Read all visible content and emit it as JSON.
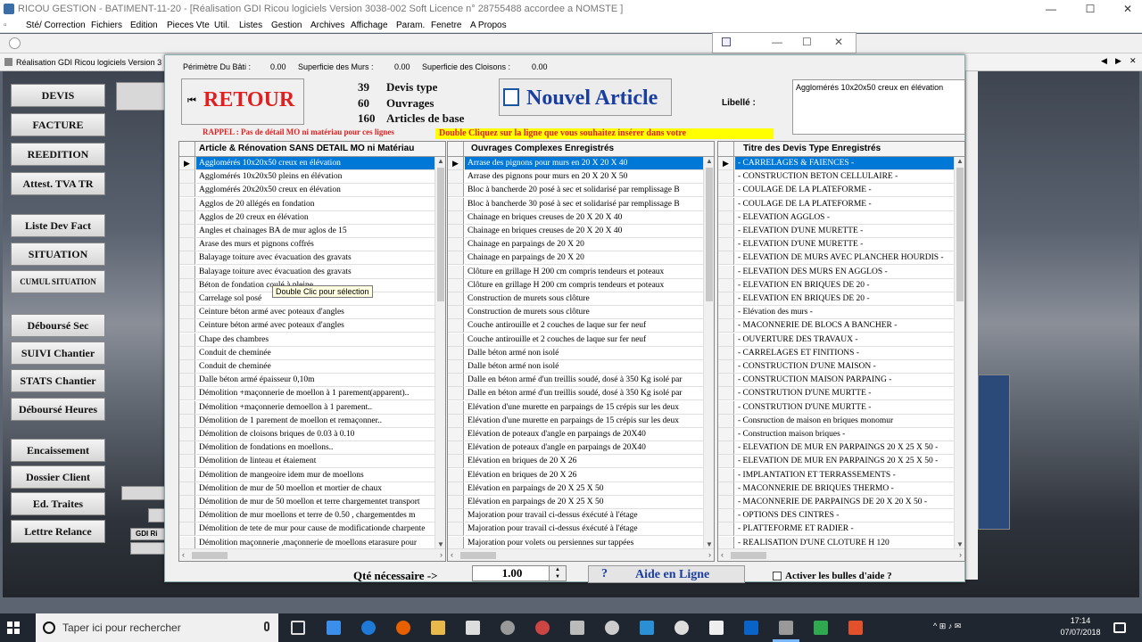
{
  "window": {
    "title": "RICOU GESTION  -  BATIMENT-11-20 - [Réalisation GDI Ricou logiciels Version 3038-002 Soft    Licence n°  28755488 accordee a NOMSTE                ]",
    "minimize": "—",
    "maximize": "☐",
    "close": "✕"
  },
  "menu": [
    "Sté/ Correction",
    "Fichiers",
    "Edition",
    "Pieces Vte",
    "Util.",
    "Listes",
    "Gestion",
    "Archives",
    "Affichage",
    "Param.",
    "Fenetre",
    "A Propos"
  ],
  "doc_tab": "Réalisation GDI Ricou logiciels Version 3",
  "doc_tab_controls": [
    "◀",
    "▶",
    "✕"
  ],
  "sidebar": [
    "DEVIS",
    "FACTURE",
    "REEDITION",
    "Attest. TVA TR",
    "Liste Dev Fact",
    "SITUATION",
    "CUMUL SITUATION",
    "Déboursé Sec",
    "SUIVI Chantier",
    "STATS Chantier",
    "Déboursé Heures",
    "Encaissement",
    "Dossier Client",
    "Ed. Traites",
    "Lettre Relance"
  ],
  "ghost_labels": [
    "GDI Ri"
  ],
  "dialog": {
    "perimetre_label": "Périmètre Du Bâti :",
    "perimetre_value": "0.00",
    "murs_label": "Superficie des Murs :",
    "murs_value": "0.00",
    "cloisons_label": "Superficie des Cloisons :",
    "cloisons_value": "0.00",
    "retour_label": "RETOUR",
    "retour_arrow": "⏮",
    "rappel": "RAPPEL : Pas de détail MO ni matériau pour ces lignes",
    "counts": [
      {
        "num": "39",
        "label": "Devis type"
      },
      {
        "num": "60",
        "label": "Ouvrages"
      },
      {
        "num": "160",
        "label": "Articles de base"
      }
    ],
    "nouvel_label": "Nouvel Article",
    "double_click_hint": "Double Cliquez sur la ligne que vous souhaitez insérer dans votre",
    "libelle_label": "Libellé :",
    "libelle_value": "Agglomérés 10x20x50 creux en élévation",
    "tooltip": "Double Clic pour sélection",
    "qty_label": "Qté nécessaire ->",
    "qty_value": "1.00",
    "aide_label": "Aide en Ligne",
    "aide_q": "?",
    "bulles_label": "Activer les bulles d'aide ?"
  },
  "grids": [
    {
      "header": "Article & Rénovation SANS DETAIL MO ni Matériau",
      "selected_row": 0,
      "rows": [
        "Agglomérés 10x20x50 creux en élévation",
        "Agglomérés 10x20x50 pleins en élévation",
        "Agglomérés 20x20x50 creux en élévation",
        "Agglos de 20 allégés en fondation",
        "Agglos de 20 creux en élévation",
        "Angles et chainages BA de mur aglos de 15",
        "Arase des murs et pignons coffrés",
        "Balayage toiture avec évacuation des gravats",
        "Balayage toiture avec évacuation des gravats",
        "Béton de fondation coulé à pleine",
        "Carrelage sol posé",
        "Ceinture béton armé avec poteaux d'angles",
        "Ceinture béton armé avec poteaux d'angles",
        "Chape des chambres",
        "Conduit de cheminée",
        "Conduit de cheminée",
        "Dalle béton armé épaisseur 0,10m",
        "Démolition +maçonnerie de moellon à 1 parement(apparent)..",
        "Démolition +maçonnerie demoellon à 1 parement..",
        "Démolition de 1 parement de moellon et remaçonner..",
        "Démolition de cloisons briques de 0.03 à 0.10",
        "Démolition de fondations en moellons..",
        "Démolition de linteau et étaiement",
        "Démolition de mangeoire idem mur de moellons",
        "Démolition de mur de 50 moellon et mortier de chaux",
        "Démolition de mur de 50 moellon et terre chargementet transport",
        "Démolition de mur moellons et terre de 0.50 , chargementdes m",
        "Démolition de tete de mur pour cause de modificationde charpente",
        "Démolition maçonnerie ,maçonnerie de moellons etarasure pour"
      ]
    },
    {
      "header": "Ouvrages Complexes Enregistrés",
      "selected_row": 0,
      "rows": [
        "Arrase des pignons pour murs en 20 X 20 X 40",
        "Arrase des pignons pour murs en 20 X 20 X 50",
        "Bloc à bancherde 20 posé à sec et solidarisé par remplissage B",
        "Bloc à bancherde 30 posé à sec et solidarisé par remplissage B",
        "Chainage en briques creuses de 20 X 20 X 40",
        "Chainage en briques creuses de 20 X 20 X 40",
        "Chainage en parpaings de 20 X 20",
        "Chainage en parpaings de 20 X 20",
        "Clôture en grillage H 200 cm compris tendeurs et poteaux",
        "Clôture en grillage H 200 cm compris tendeurs et poteaux",
        "Construction de murets sous clôture",
        "Construction de murets sous clôture",
        "Couche antirouille et 2 couches de laque sur fer neuf",
        "Couche antirouille et 2 couches de laque sur fer neuf",
        "Dalle béton armé non isolé",
        "Dalle béton armé non isolé",
        "Dalle en béton armé d'un treillis soudé, dosé à 350 Kg isolé par",
        "Dalle en béton armé d'un treillis soudé, dosé à 350 Kg isolé par",
        "Elévation d'une murette en parpaings de 15 crépis sur les deux",
        "Elévation d'une murette en parpaings de 15 crépis sur les deux",
        "Elévation de poteaux d'angle en parpaings de 20X40",
        "Elévation de poteaux d'angle en parpaings de 20X40",
        "Elévation en briques de 20 X 26",
        "Elévation en briques de 20 X 26",
        "Elévation en parpaings de 20 X 25 X 50",
        "Elévation en parpaings de 20 X 25 X 50",
        "Majoration pour travail ci-dessus éxécuté à l'étage",
        "Majoration pour travail ci-dessus éxécuté à l'étage",
        "Majoration pour volets ou persiennes sur tappées"
      ]
    },
    {
      "header": "Titre des Devis Type Enregistrés",
      "selected_row": 0,
      "rows": [
        "-  CARRELAGES & FAIENCES  -",
        "-  CONSTRUCTION BETON CELLULAIRE  -",
        "-  COULAGE DE LA PLATEFORME  -",
        "-  COULAGE DE LA PLATEFORME  -",
        "-  ELEVATION AGGLOS  -",
        "-  ELEVATION D'UNE MURETTE  -",
        "-  ELEVATION D'UNE MURETTE  -",
        "-  ELEVATION DE MURS AVEC PLANCHER HOURDIS  -",
        "-  ELEVATION DES MURS  EN AGGLOS -",
        "-  ELEVATION EN BRIQUES DE 20  -",
        "-  ELEVATION EN BRIQUES DE 20  -",
        "-  Elévation des murs  -",
        "-  MACONNERIE DE BLOCS A BANCHER  -",
        "-  OUVERTURE DES TRAVAUX  -",
        "- CARRELAGES ET FINITIONS -",
        "- CONSTRUCTION D'UNE MAISON  -",
        "- CONSTRUCTION MAISON PARPAING -",
        "- CONSTRUTION D'UNE MURTTE  -",
        "- CONSTRUTION D'UNE MURTTE  -",
        "- Consruction de maison en briques monomur",
        "- Construction maison briques -",
        "- ELEVATION DE MUR EN PARPAINGS 20 X 25 X 50 -",
        "- ELEVATION DE MUR EN PARPAINGS 20 X 25 X 50 -",
        "- IMPLANTATION ET TERRASSEMENTS -",
        "- MACONNERIE DE BRIQUES THERMO -",
        "- MACONNERIE DE PARPAINGS DE 20 X 20 X 50 -",
        "- OPTIONS DES CINTRES -",
        "- PLATTEFORME ET RADIER -",
        "- REALISATION D'UNE CLOTURE H 120"
      ]
    }
  ],
  "taskbar": {
    "search_placeholder": "Taper ici pour rechercher",
    "time": "17:14",
    "date": "07/07/2018",
    "tray": "^  ⊞  ♪  ✉"
  }
}
